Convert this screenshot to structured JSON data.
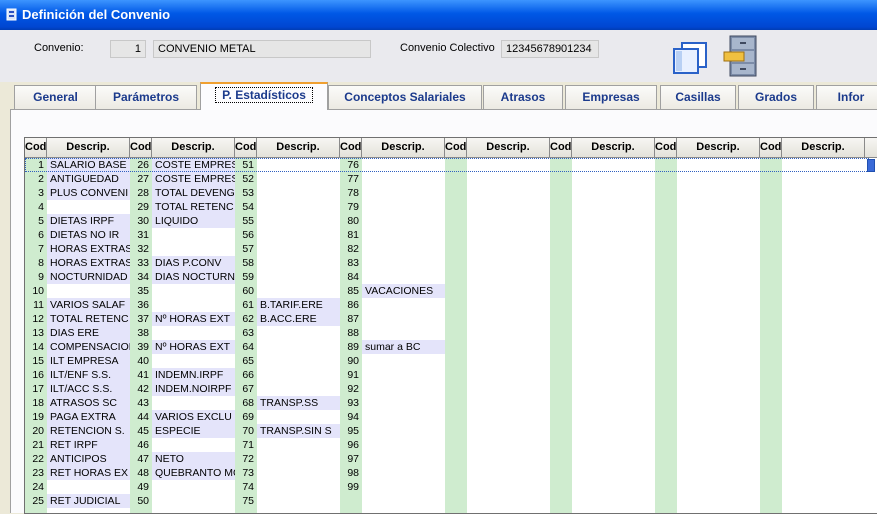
{
  "window": {
    "title": "Definición del Convenio"
  },
  "header": {
    "convenio_label": "Convenio:",
    "convenio_number": "1",
    "convenio_name": "CONVENIO METAL",
    "colectivo_label": "Convenio Colectivo",
    "colectivo_value": "12345678901234"
  },
  "tabs": [
    "General",
    "Parámetros",
    "P. Estadísticos",
    "Conceptos Salariales",
    "Atrasos",
    "Empresas",
    "Casillas",
    "Grados",
    "Infor"
  ],
  "active_tab": "P. Estadísticos",
  "grid": {
    "cod_header": "Cod",
    "desc_header": "Descrip.",
    "groups": [
      {
        "rows": [
          [
            "1",
            "SALARIO BASE"
          ],
          [
            "2",
            "ANTIGUEDAD"
          ],
          [
            "3",
            "PLUS CONVENI"
          ],
          [
            "4",
            ""
          ],
          [
            "5",
            "DIETAS IRPF"
          ],
          [
            "6",
            "DIETAS NO IR"
          ],
          [
            "7",
            "HORAS EXTRAS"
          ],
          [
            "8",
            "HORAS EXTRAS"
          ],
          [
            "9",
            "NOCTURNIDAD"
          ],
          [
            "10",
            ""
          ],
          [
            "11",
            "VARIOS SALAF"
          ],
          [
            "12",
            "TOTAL RETENC"
          ],
          [
            "13",
            "DIAS ERE"
          ],
          [
            "14",
            "COMPENSACION"
          ],
          [
            "15",
            "ILT EMPRESA"
          ],
          [
            "16",
            "ILT/ENF S.S."
          ],
          [
            "17",
            "ILT/ACC S.S."
          ],
          [
            "18",
            "ATRASOS SC"
          ],
          [
            "19",
            "PAGA EXTRA"
          ],
          [
            "20",
            "RETENCION S."
          ],
          [
            "21",
            "RET IRPF"
          ],
          [
            "22",
            "ANTICIPOS"
          ],
          [
            "23",
            "RET HORAS EX"
          ],
          [
            "24",
            ""
          ],
          [
            "25",
            "RET JUDICIAL"
          ]
        ]
      },
      {
        "rows": [
          [
            "26",
            "COSTE EMPRES"
          ],
          [
            "27",
            "COSTE EMPRES"
          ],
          [
            "28",
            "TOTAL DEVENG"
          ],
          [
            "29",
            "TOTAL RETENC"
          ],
          [
            "30",
            "LIQUIDO"
          ],
          [
            "31",
            ""
          ],
          [
            "32",
            ""
          ],
          [
            "33",
            "DIAS P.CONV"
          ],
          [
            "34",
            "DIAS NOCTURN"
          ],
          [
            "35",
            ""
          ],
          [
            "36",
            ""
          ],
          [
            "37",
            "Nº HORAS EXT"
          ],
          [
            "38",
            ""
          ],
          [
            "39",
            "Nº HORAS EXT"
          ],
          [
            "40",
            ""
          ],
          [
            "41",
            "INDEMN.IRPF"
          ],
          [
            "42",
            "INDEM.NOIRPF"
          ],
          [
            "43",
            ""
          ],
          [
            "44",
            "VARIOS EXCLU"
          ],
          [
            "45",
            "ESPECIE"
          ],
          [
            "46",
            ""
          ],
          [
            "47",
            "NETO"
          ],
          [
            "48",
            "QUEBRANTO MO"
          ],
          [
            "49",
            ""
          ],
          [
            "50",
            ""
          ]
        ]
      },
      {
        "rows": [
          [
            "51",
            ""
          ],
          [
            "52",
            ""
          ],
          [
            "53",
            ""
          ],
          [
            "54",
            ""
          ],
          [
            "55",
            ""
          ],
          [
            "56",
            ""
          ],
          [
            "57",
            ""
          ],
          [
            "58",
            ""
          ],
          [
            "59",
            ""
          ],
          [
            "60",
            ""
          ],
          [
            "61",
            "B.TARIF.ERE"
          ],
          [
            "62",
            "B.ACC.ERE"
          ],
          [
            "63",
            ""
          ],
          [
            "64",
            ""
          ],
          [
            "65",
            ""
          ],
          [
            "66",
            ""
          ],
          [
            "67",
            ""
          ],
          [
            "68",
            "TRANSP.SS"
          ],
          [
            "69",
            ""
          ],
          [
            "70",
            "TRANSP.SIN S"
          ],
          [
            "71",
            ""
          ],
          [
            "72",
            ""
          ],
          [
            "73",
            ""
          ],
          [
            "74",
            ""
          ],
          [
            "75",
            ""
          ]
        ]
      },
      {
        "rows": [
          [
            "76",
            ""
          ],
          [
            "77",
            ""
          ],
          [
            "78",
            ""
          ],
          [
            "79",
            ""
          ],
          [
            "80",
            ""
          ],
          [
            "81",
            ""
          ],
          [
            "82",
            ""
          ],
          [
            "83",
            ""
          ],
          [
            "84",
            ""
          ],
          [
            "85",
            "VACACIONES"
          ],
          [
            "86",
            ""
          ],
          [
            "87",
            ""
          ],
          [
            "88",
            ""
          ],
          [
            "89",
            "sumar a BC"
          ],
          [
            "90",
            ""
          ],
          [
            "91",
            ""
          ],
          [
            "92",
            ""
          ],
          [
            "93",
            ""
          ],
          [
            "94",
            ""
          ],
          [
            "95",
            ""
          ],
          [
            "96",
            ""
          ],
          [
            "97",
            ""
          ],
          [
            "98",
            ""
          ],
          [
            "99",
            ""
          ]
        ]
      },
      {
        "rows": []
      },
      {
        "rows": []
      },
      {
        "rows": []
      },
      {
        "rows": []
      }
    ]
  },
  "colors": {
    "cod_green": "#cfeccf",
    "desc_lavender": "#e4e4fa",
    "title_blue": "#0058e6",
    "tab_text": "#1b3a8c"
  }
}
